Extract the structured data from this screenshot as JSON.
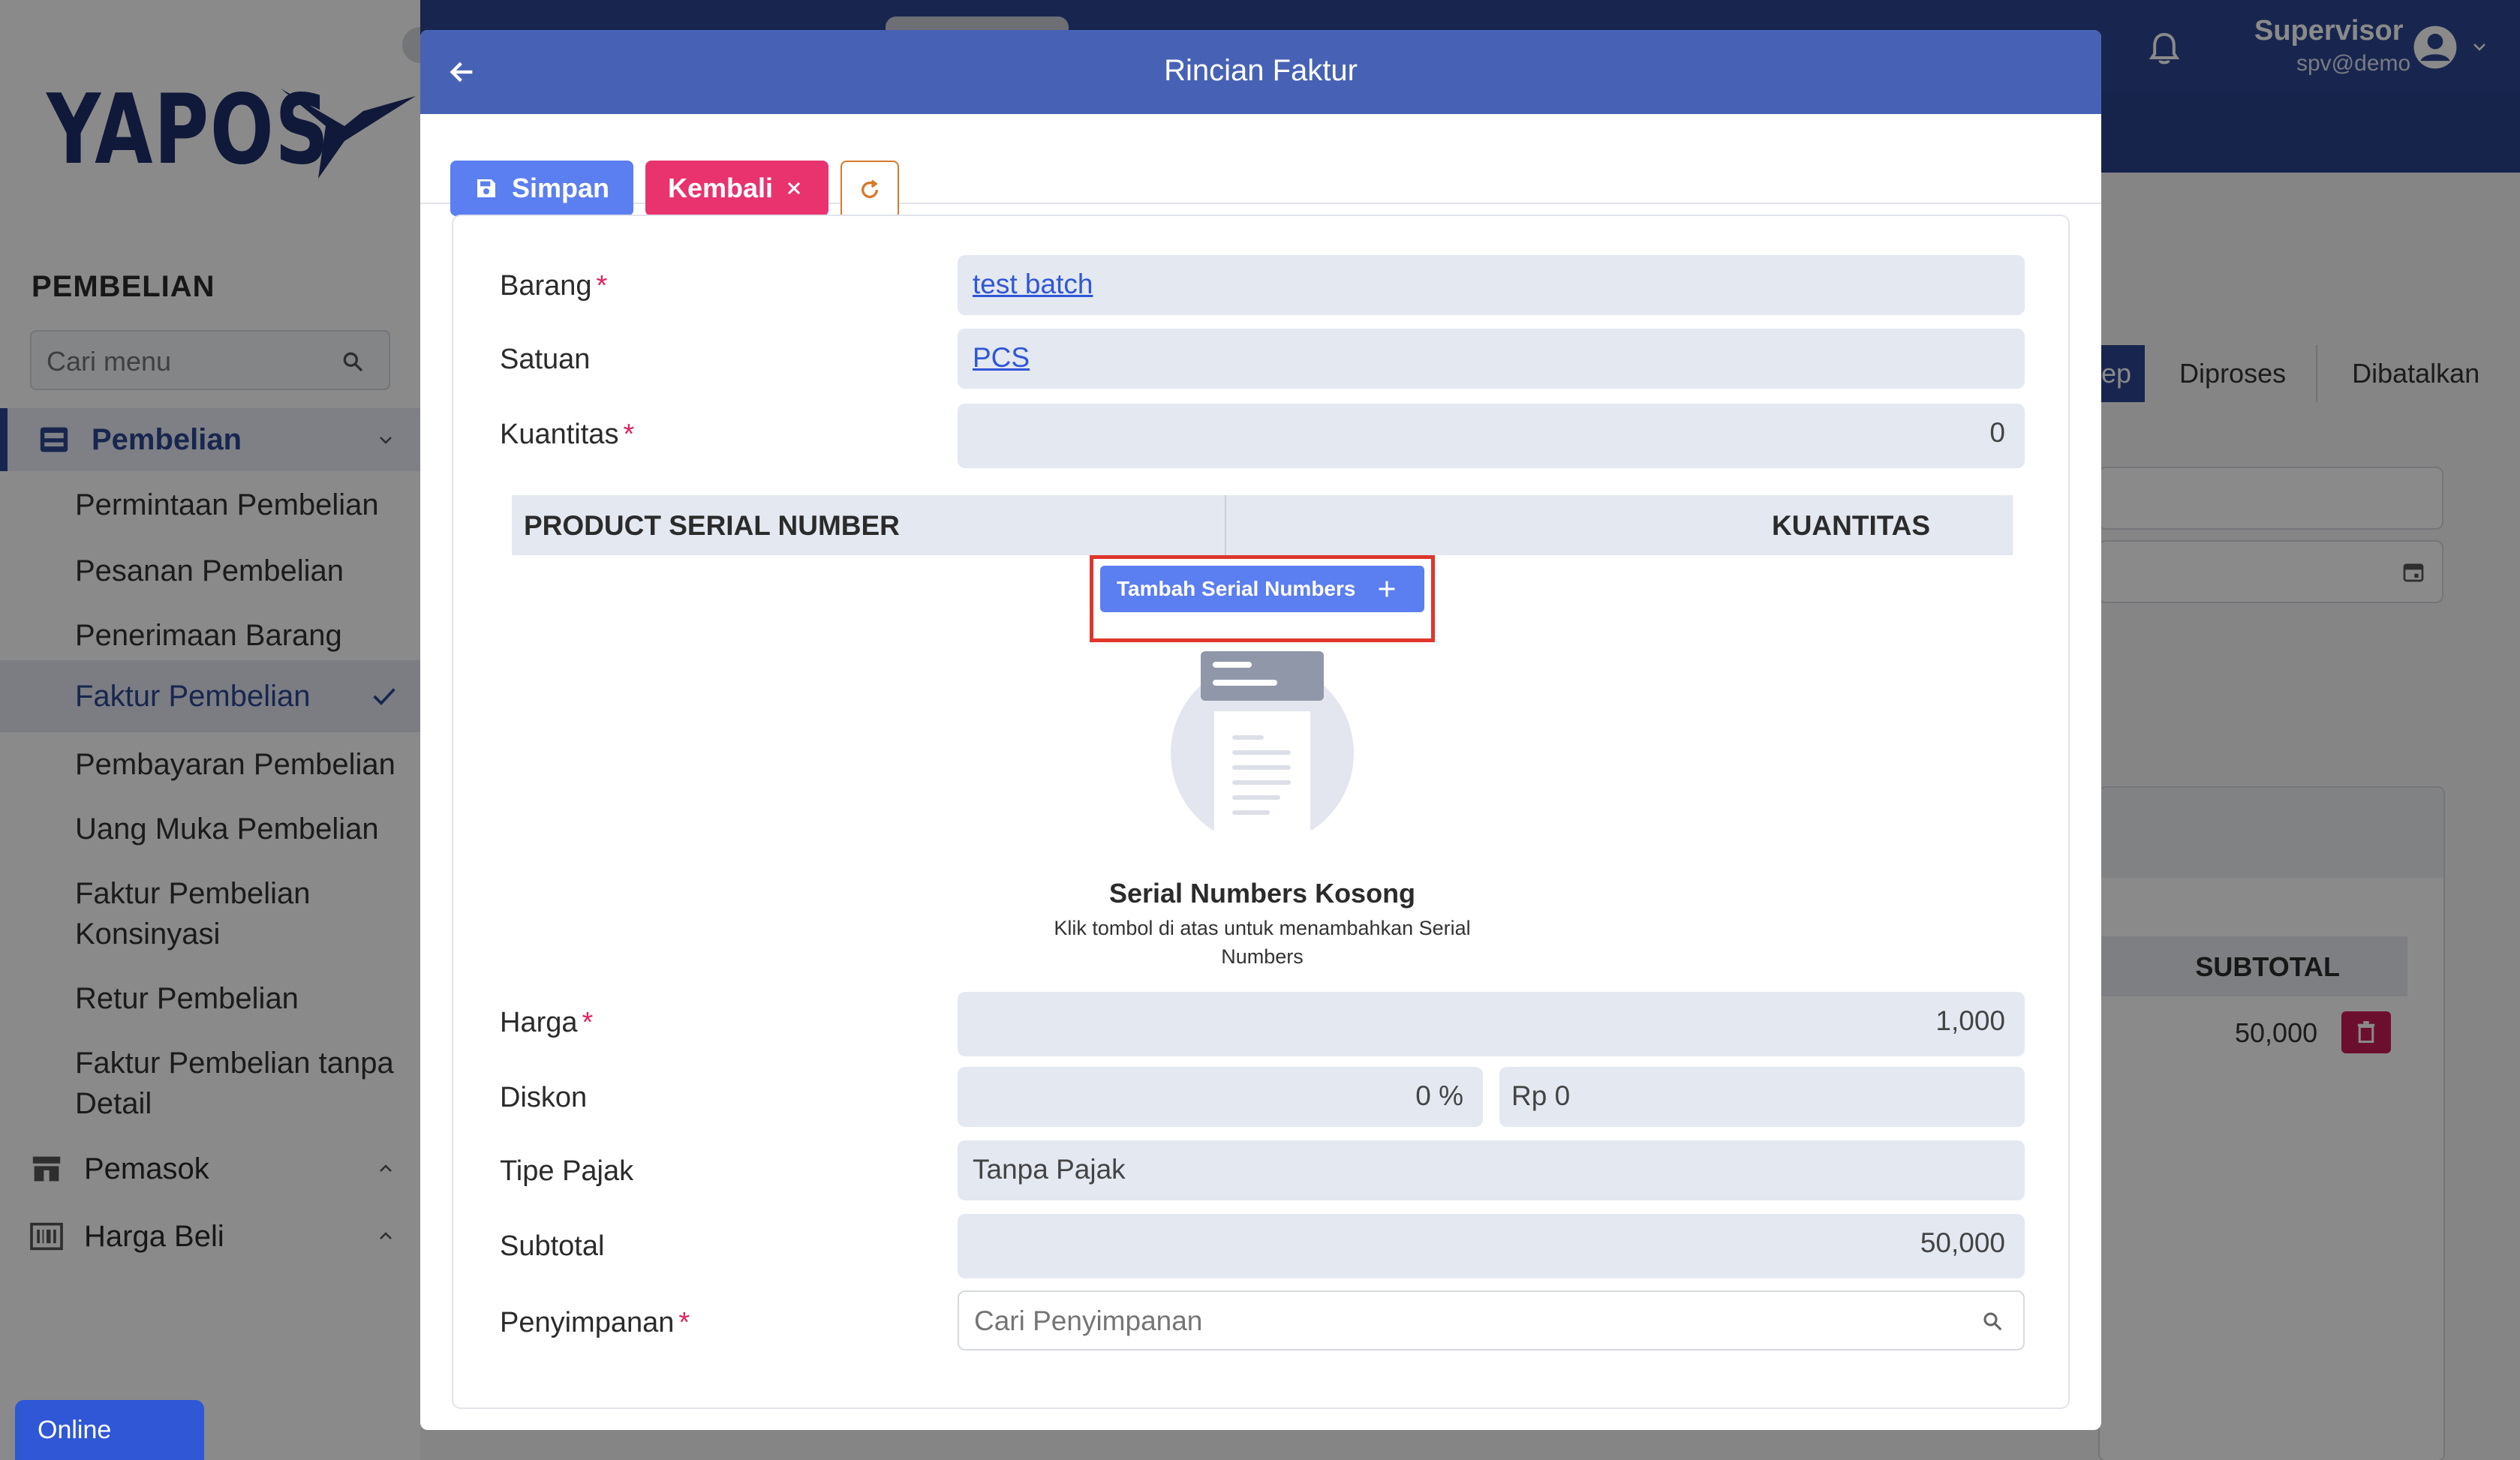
{
  "app": {
    "logo": "YAPOS",
    "section_title": "PEMBELIAN",
    "menu_search_placeholder": "Cari menu",
    "online_status": "Online"
  },
  "sidebar": {
    "groups": [
      {
        "label": "Pembelian",
        "icon": "inbox-icon",
        "expanded": true
      },
      {
        "label": "Pemasok",
        "icon": "store-icon",
        "expanded": false
      },
      {
        "label": "Harga Beli",
        "icon": "barcode-icon",
        "expanded": false
      }
    ],
    "items": [
      {
        "label": "Permintaan Pembelian"
      },
      {
        "label": "Pesanan Pembelian"
      },
      {
        "label": "Penerimaan Barang"
      },
      {
        "label": "Faktur Pembelian",
        "active": true
      },
      {
        "label": "Pembayaran Pembelian"
      },
      {
        "label": "Uang Muka Pembelian"
      },
      {
        "label": "Faktur Pembelian Konsinyasi"
      },
      {
        "label": "Retur Pembelian"
      },
      {
        "label": "Faktur Pembelian tanpa Detail"
      }
    ]
  },
  "header": {
    "user_name": "Supervisor",
    "user_account": "spv@demo"
  },
  "background": {
    "steps": [
      "ep",
      "Diproses",
      "Dibatalkan"
    ],
    "table_header": "SUBTOTAL",
    "row_subtotal": "50,000"
  },
  "modal": {
    "title": "Rincian Faktur",
    "save_label": "Simpan",
    "back_label": "Kembali",
    "fields": {
      "barang_label": "Barang",
      "barang_value": "test batch",
      "satuan_label": "Satuan",
      "satuan_value": "PCS",
      "kuantitas_label": "Kuantitas",
      "kuantitas_value": "0",
      "harga_label": "Harga",
      "harga_value": "1,000",
      "diskon_label": "Diskon",
      "diskon_percent": "0 %",
      "diskon_amount": "Rp 0",
      "tipe_pajak_label": "Tipe Pajak",
      "tipe_pajak_value": "Tanpa Pajak",
      "subtotal_label": "Subtotal",
      "subtotal_value": "50,000",
      "penyimpanan_label": "Penyimpanan",
      "penyimpanan_placeholder": "Cari Penyimpanan"
    },
    "serial_table": {
      "col_serial": "PRODUCT SERIAL NUMBER",
      "col_qty": "KUANTITAS",
      "add_button": "Tambah Serial Numbers",
      "empty_title": "Serial Numbers Kosong",
      "empty_desc": "Klik tombol di atas untuk menambahkan Serial Numbers"
    }
  },
  "colors": {
    "primary": "#2d4693",
    "modal_header": "#4762b5",
    "save_button": "#5b7ef0",
    "back_button": "#e8336e",
    "highlight": "#e0362c"
  }
}
